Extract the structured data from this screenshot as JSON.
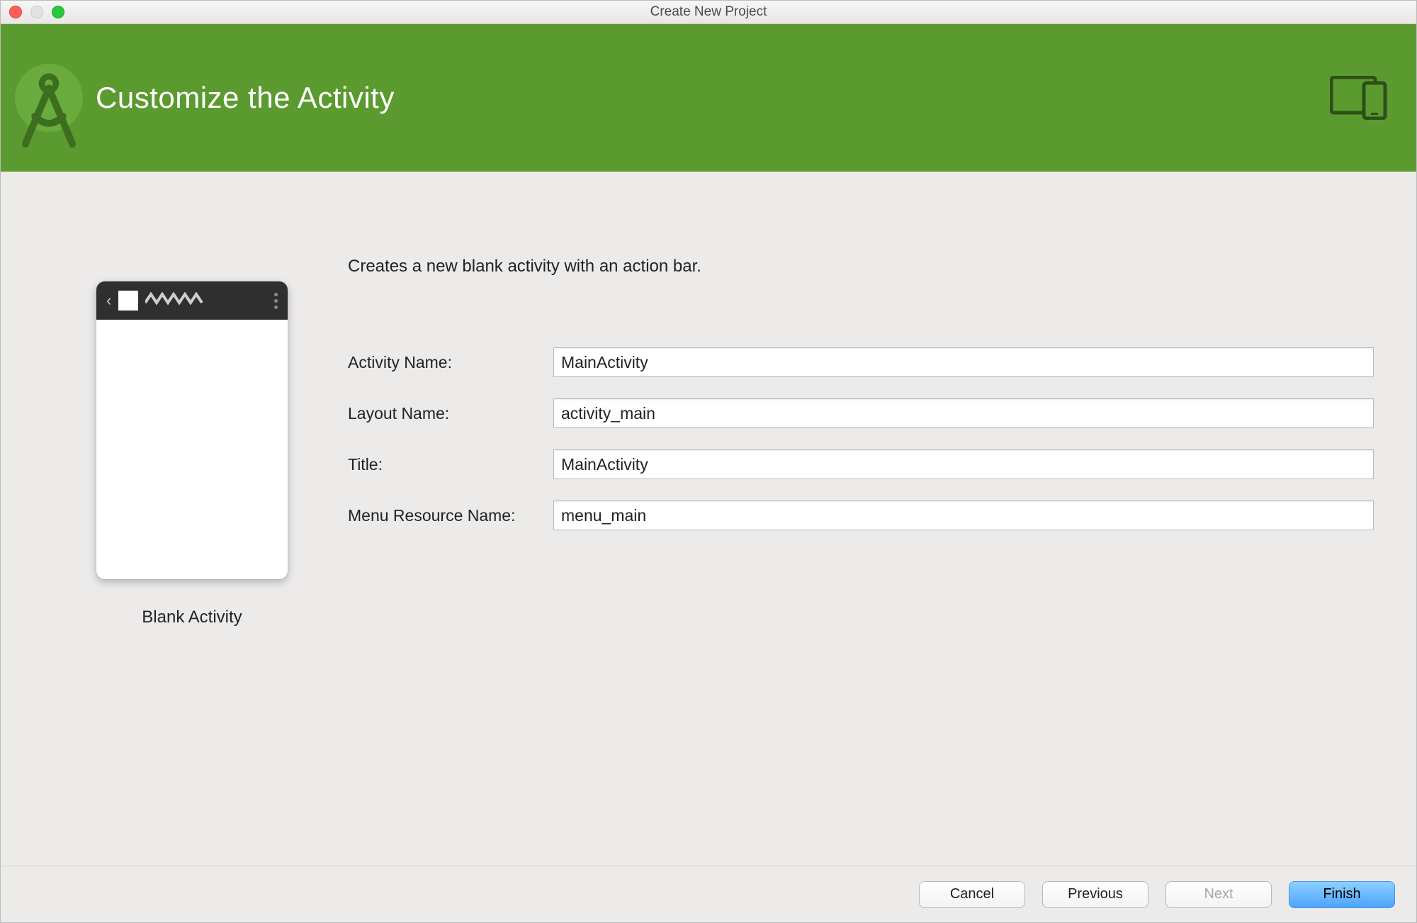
{
  "window": {
    "title": "Create New Project"
  },
  "header": {
    "title": "Customize the Activity"
  },
  "description": "Creates a new blank activity with an action bar.",
  "preview": {
    "label": "Blank Activity"
  },
  "form": {
    "activity_name": {
      "label": "Activity Name:",
      "value": "MainActivity"
    },
    "layout_name": {
      "label": "Layout Name:",
      "value": "activity_main"
    },
    "title": {
      "label": "Title:",
      "value": "MainActivity"
    },
    "menu_resource": {
      "label": "Menu Resource Name:",
      "value": "menu_main"
    }
  },
  "footer": {
    "cancel": "Cancel",
    "previous": "Previous",
    "next": "Next",
    "finish": "Finish",
    "next_enabled": false
  }
}
